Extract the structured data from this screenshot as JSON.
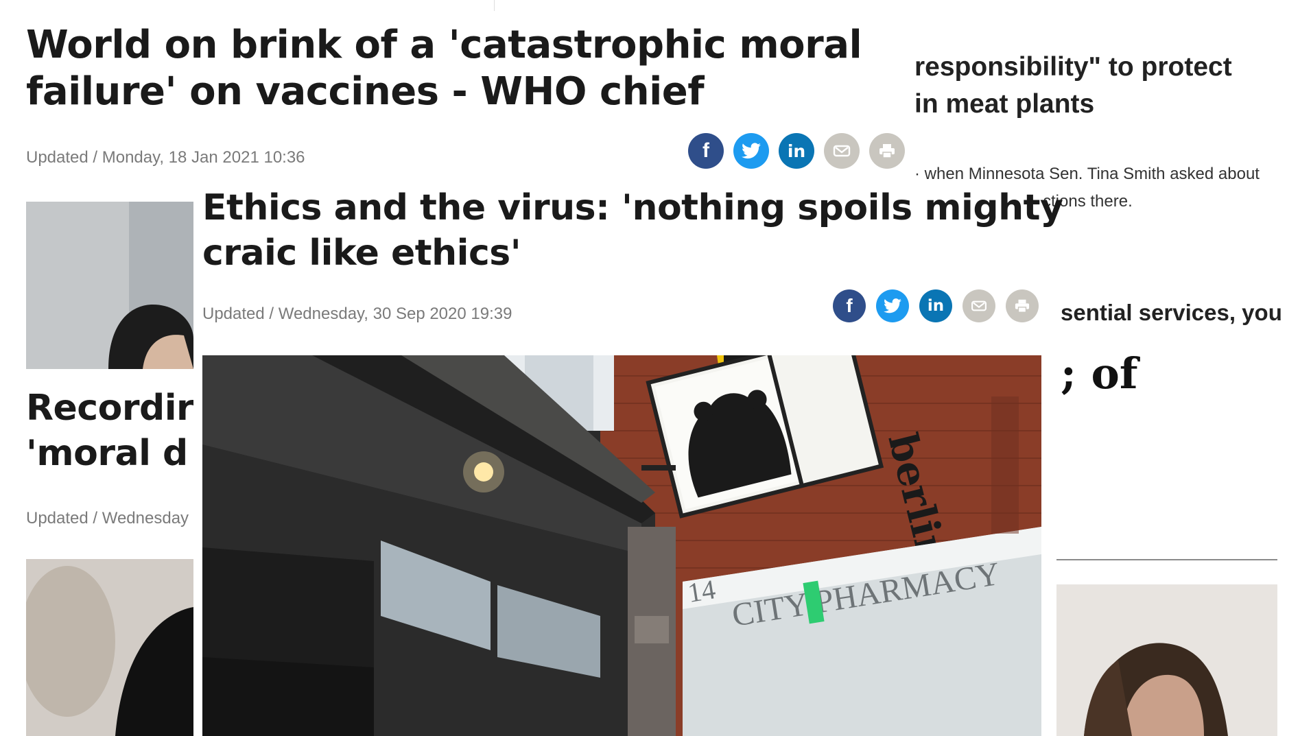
{
  "back_article": {
    "headline": "World on brink of a 'catastrophic moral failure' on vaccines - WHO chief",
    "headline_line1": "World on brink of a 'catastrophic moral",
    "headline_line2": "failure' on vaccines - WHO chief",
    "dateline": "Updated / Monday, 18 Jan 2021 10:36",
    "second_headline_line1": "Recordir",
    "second_headline_line2": "'moral d",
    "second_dateline": "Updated / Wednesday"
  },
  "right_fragment": {
    "headline_line1": "responsibility\" to protect",
    "headline_line2": " in meat plants",
    "small_line1": "· when Minnesota Sen. Tina Smith asked about",
    "small_line2": "ctions there.",
    "bold_line": "sential services, you",
    "serif_line": "; of"
  },
  "front_article": {
    "headline_line1": "Ethics and the virus: 'nothing spoils mighty",
    "headline_line2": "craic like ethics'",
    "dateline": "Updated / Wednesday, 30 Sep 2020 19:39",
    "photo_sign_text": "berlin",
    "photo_shop_text": "CITY PHARMACY",
    "photo_number": "14"
  },
  "share_icons": {
    "facebook": "f",
    "twitter": "twitter-bird",
    "linkedin": "in",
    "email": "envelope",
    "print": "printer"
  },
  "colors": {
    "facebook": "#2f4e8a",
    "twitter": "#1d9bf0",
    "linkedin": "#0a75b4",
    "email": "#c9c6bf",
    "print": "#c9c6bf",
    "dateline": "#7a7a7a"
  }
}
